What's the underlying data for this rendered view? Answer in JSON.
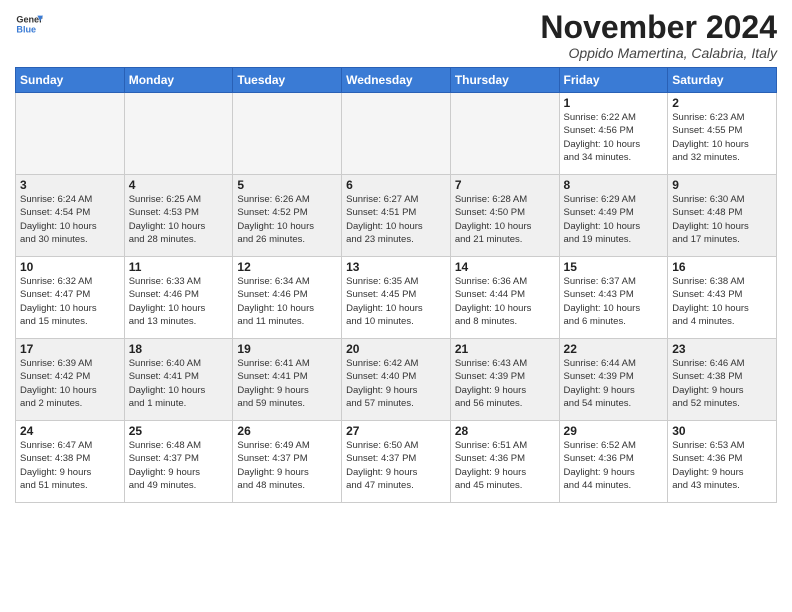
{
  "header": {
    "logo_general": "General",
    "logo_blue": "Blue",
    "month_title": "November 2024",
    "location": "Oppido Mamertina, Calabria, Italy"
  },
  "weekdays": [
    "Sunday",
    "Monday",
    "Tuesday",
    "Wednesday",
    "Thursday",
    "Friday",
    "Saturday"
  ],
  "weeks": [
    [
      {
        "day": "",
        "info": ""
      },
      {
        "day": "",
        "info": ""
      },
      {
        "day": "",
        "info": ""
      },
      {
        "day": "",
        "info": ""
      },
      {
        "day": "",
        "info": ""
      },
      {
        "day": "1",
        "info": "Sunrise: 6:22 AM\nSunset: 4:56 PM\nDaylight: 10 hours\nand 34 minutes."
      },
      {
        "day": "2",
        "info": "Sunrise: 6:23 AM\nSunset: 4:55 PM\nDaylight: 10 hours\nand 32 minutes."
      }
    ],
    [
      {
        "day": "3",
        "info": "Sunrise: 6:24 AM\nSunset: 4:54 PM\nDaylight: 10 hours\nand 30 minutes."
      },
      {
        "day": "4",
        "info": "Sunrise: 6:25 AM\nSunset: 4:53 PM\nDaylight: 10 hours\nand 28 minutes."
      },
      {
        "day": "5",
        "info": "Sunrise: 6:26 AM\nSunset: 4:52 PM\nDaylight: 10 hours\nand 26 minutes."
      },
      {
        "day": "6",
        "info": "Sunrise: 6:27 AM\nSunset: 4:51 PM\nDaylight: 10 hours\nand 23 minutes."
      },
      {
        "day": "7",
        "info": "Sunrise: 6:28 AM\nSunset: 4:50 PM\nDaylight: 10 hours\nand 21 minutes."
      },
      {
        "day": "8",
        "info": "Sunrise: 6:29 AM\nSunset: 4:49 PM\nDaylight: 10 hours\nand 19 minutes."
      },
      {
        "day": "9",
        "info": "Sunrise: 6:30 AM\nSunset: 4:48 PM\nDaylight: 10 hours\nand 17 minutes."
      }
    ],
    [
      {
        "day": "10",
        "info": "Sunrise: 6:32 AM\nSunset: 4:47 PM\nDaylight: 10 hours\nand 15 minutes."
      },
      {
        "day": "11",
        "info": "Sunrise: 6:33 AM\nSunset: 4:46 PM\nDaylight: 10 hours\nand 13 minutes."
      },
      {
        "day": "12",
        "info": "Sunrise: 6:34 AM\nSunset: 4:46 PM\nDaylight: 10 hours\nand 11 minutes."
      },
      {
        "day": "13",
        "info": "Sunrise: 6:35 AM\nSunset: 4:45 PM\nDaylight: 10 hours\nand 10 minutes."
      },
      {
        "day": "14",
        "info": "Sunrise: 6:36 AM\nSunset: 4:44 PM\nDaylight: 10 hours\nand 8 minutes."
      },
      {
        "day": "15",
        "info": "Sunrise: 6:37 AM\nSunset: 4:43 PM\nDaylight: 10 hours\nand 6 minutes."
      },
      {
        "day": "16",
        "info": "Sunrise: 6:38 AM\nSunset: 4:43 PM\nDaylight: 10 hours\nand 4 minutes."
      }
    ],
    [
      {
        "day": "17",
        "info": "Sunrise: 6:39 AM\nSunset: 4:42 PM\nDaylight: 10 hours\nand 2 minutes."
      },
      {
        "day": "18",
        "info": "Sunrise: 6:40 AM\nSunset: 4:41 PM\nDaylight: 10 hours\nand 1 minute."
      },
      {
        "day": "19",
        "info": "Sunrise: 6:41 AM\nSunset: 4:41 PM\nDaylight: 9 hours\nand 59 minutes."
      },
      {
        "day": "20",
        "info": "Sunrise: 6:42 AM\nSunset: 4:40 PM\nDaylight: 9 hours\nand 57 minutes."
      },
      {
        "day": "21",
        "info": "Sunrise: 6:43 AM\nSunset: 4:39 PM\nDaylight: 9 hours\nand 56 minutes."
      },
      {
        "day": "22",
        "info": "Sunrise: 6:44 AM\nSunset: 4:39 PM\nDaylight: 9 hours\nand 54 minutes."
      },
      {
        "day": "23",
        "info": "Sunrise: 6:46 AM\nSunset: 4:38 PM\nDaylight: 9 hours\nand 52 minutes."
      }
    ],
    [
      {
        "day": "24",
        "info": "Sunrise: 6:47 AM\nSunset: 4:38 PM\nDaylight: 9 hours\nand 51 minutes."
      },
      {
        "day": "25",
        "info": "Sunrise: 6:48 AM\nSunset: 4:37 PM\nDaylight: 9 hours\nand 49 minutes."
      },
      {
        "day": "26",
        "info": "Sunrise: 6:49 AM\nSunset: 4:37 PM\nDaylight: 9 hours\nand 48 minutes."
      },
      {
        "day": "27",
        "info": "Sunrise: 6:50 AM\nSunset: 4:37 PM\nDaylight: 9 hours\nand 47 minutes."
      },
      {
        "day": "28",
        "info": "Sunrise: 6:51 AM\nSunset: 4:36 PM\nDaylight: 9 hours\nand 45 minutes."
      },
      {
        "day": "29",
        "info": "Sunrise: 6:52 AM\nSunset: 4:36 PM\nDaylight: 9 hours\nand 44 minutes."
      },
      {
        "day": "30",
        "info": "Sunrise: 6:53 AM\nSunset: 4:36 PM\nDaylight: 9 hours\nand 43 minutes."
      }
    ]
  ]
}
